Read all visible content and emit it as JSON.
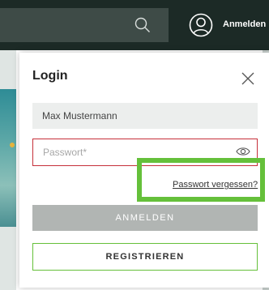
{
  "header": {
    "login_label": "Anmelden",
    "search_icon": "search-icon",
    "account_icon": "user-account-icon"
  },
  "modal": {
    "title": "Login",
    "close_icon": "close-icon",
    "name_value": "Max Mustermann",
    "password_placeholder": "Passwort*",
    "password_icon": "eye-icon",
    "forgot_password": "Passwort vergessen?",
    "login_button": "ANMELDEN",
    "register_button": "REGISTRIEREN"
  },
  "colors": {
    "header_bg": "#1c2a26",
    "error_border": "#c6303a",
    "highlight_green": "#65c03a",
    "disabled_button": "#b1b5b3"
  }
}
